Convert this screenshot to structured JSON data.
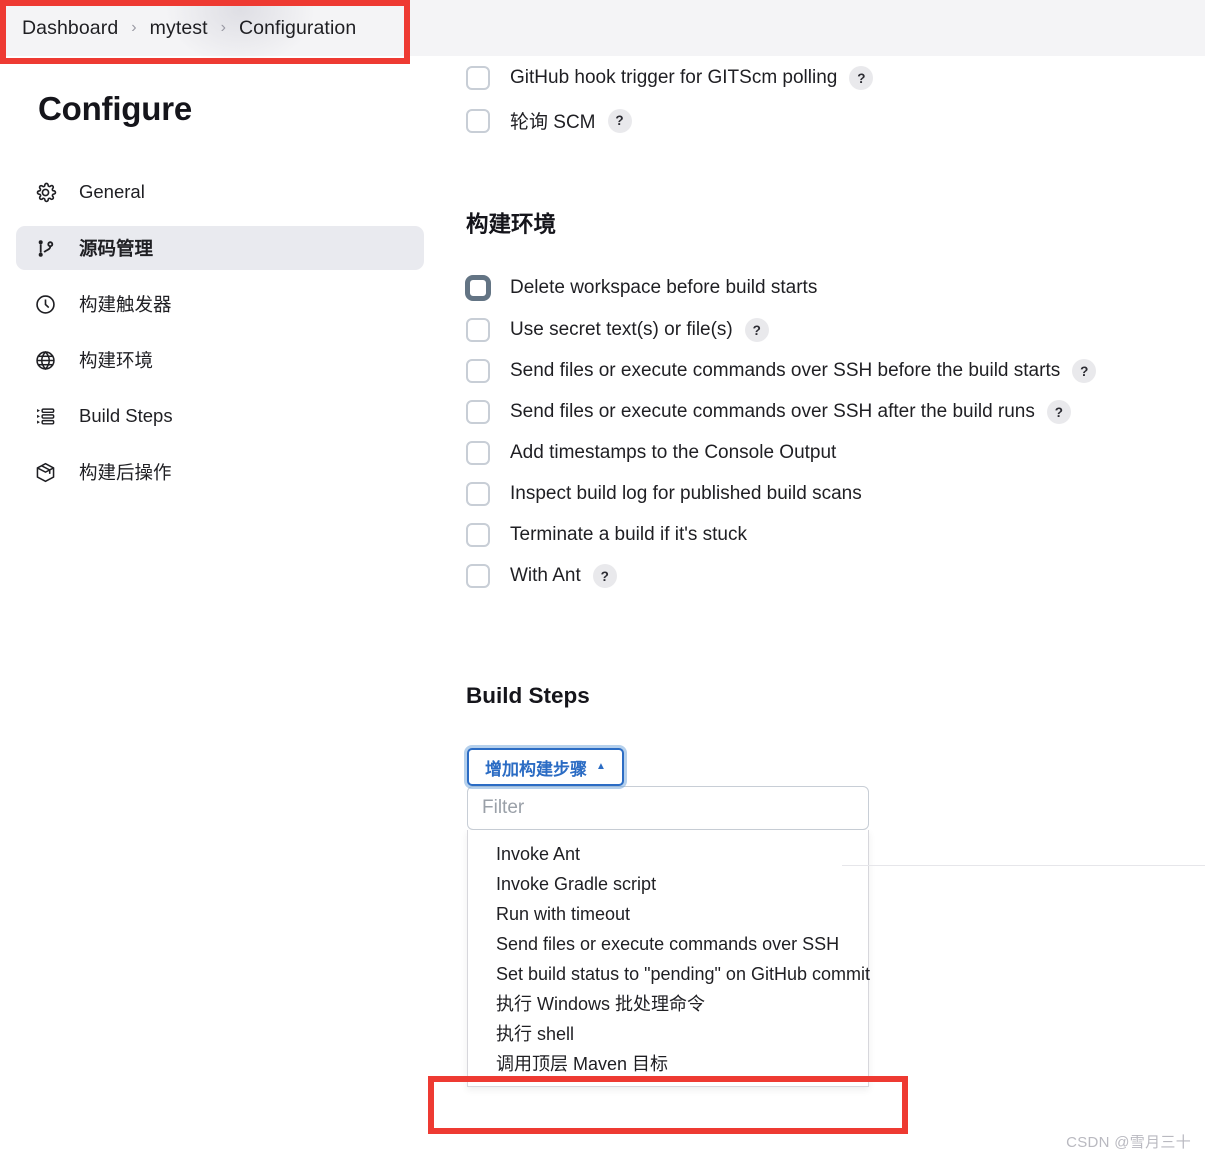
{
  "breadcrumb": {
    "items": [
      "Dashboard",
      "mytest",
      "Configuration"
    ],
    "separator": "›"
  },
  "sidebar": {
    "title": "Configure",
    "items": [
      {
        "label": "General",
        "icon": "gear-icon",
        "active": false
      },
      {
        "label": "源码管理",
        "icon": "git-branch-icon",
        "active": true
      },
      {
        "label": "构建触发器",
        "icon": "clock-icon",
        "active": false
      },
      {
        "label": "构建环境",
        "icon": "globe-icon",
        "active": false
      },
      {
        "label": "Build Steps",
        "icon": "list-steps-icon",
        "active": false
      },
      {
        "label": "构建后操作",
        "icon": "package-icon",
        "active": false
      }
    ]
  },
  "triggers": {
    "checkboxes": [
      {
        "label": "GitHub hook trigger for GITScm polling",
        "help": true,
        "checked": false,
        "hover": false
      },
      {
        "label": "轮询 SCM",
        "help": true,
        "checked": false,
        "hover": false
      }
    ]
  },
  "build_environment": {
    "heading": "构建环境",
    "checkboxes": [
      {
        "label": "Delete workspace before build starts",
        "help": false,
        "checked": false,
        "hover": true
      },
      {
        "label": "Use secret text(s) or file(s)",
        "help": true,
        "checked": false,
        "hover": false
      },
      {
        "label": "Send files or execute commands over SSH before the build starts",
        "help": true,
        "checked": false,
        "hover": false
      },
      {
        "label": "Send files or execute commands over SSH after the build runs",
        "help": true,
        "checked": false,
        "hover": false
      },
      {
        "label": "Add timestamps to the Console Output",
        "help": false,
        "checked": false,
        "hover": false
      },
      {
        "label": "Inspect build log for published build scans",
        "help": false,
        "checked": false,
        "hover": false
      },
      {
        "label": "Terminate a build if it's stuck",
        "help": false,
        "checked": false,
        "hover": false
      },
      {
        "label": "With Ant",
        "help": true,
        "checked": false,
        "hover": false
      }
    ]
  },
  "build_steps": {
    "heading": "Build Steps",
    "add_button_label": "增加构建步骤",
    "add_button_caret": "▲",
    "filter_placeholder": "Filter",
    "filter_value": "",
    "menu_items": [
      "Invoke Ant",
      "Invoke Gradle script",
      "Run with timeout",
      "Send files or execute commands over SSH",
      "Set build status to \"pending\" on GitHub commit",
      "执行 Windows 批处理命令",
      "执行 shell",
      "调用顶层 Maven 目标"
    ]
  },
  "help_glyph": "?",
  "watermark": "CSDN @雪月三十",
  "colors": {
    "annotation_red": "#ee3a32",
    "accent_blue": "#2b6cc4",
    "active_nav_bg": "#e9eaef",
    "breadcrumb_bg": "#f4f4f6",
    "checkbox_hover_border": "#637484"
  }
}
